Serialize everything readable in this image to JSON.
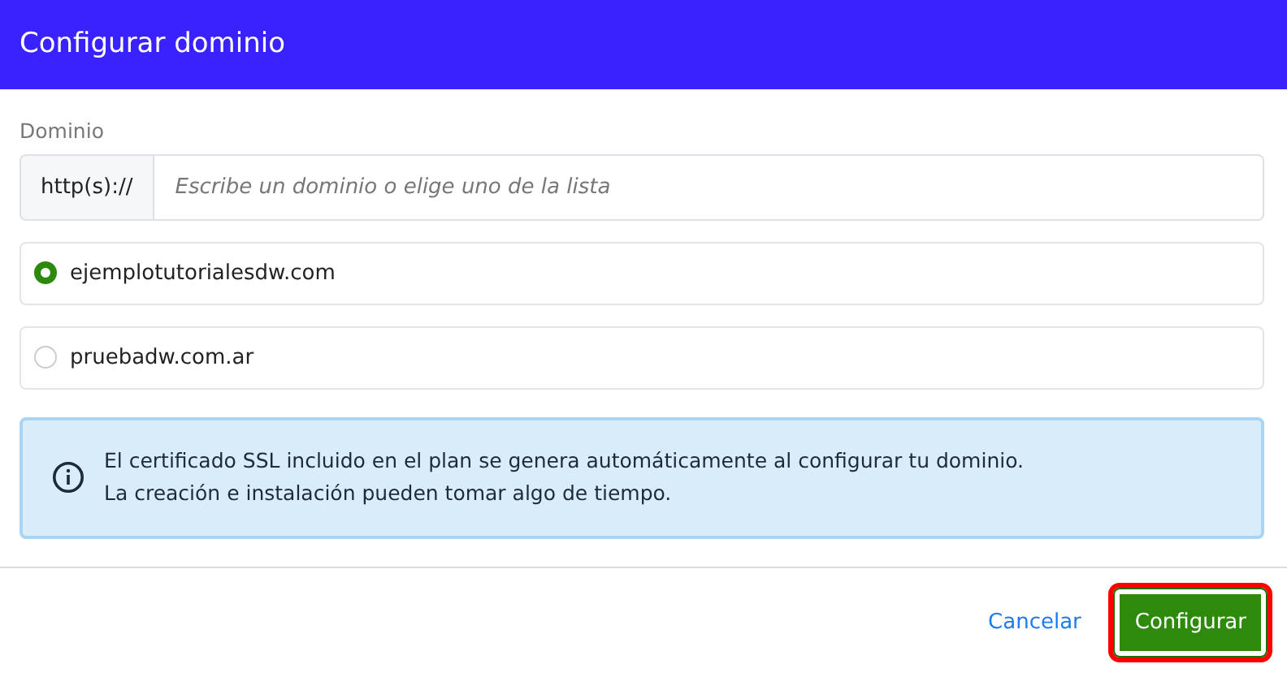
{
  "header": {
    "title": "Configurar dominio"
  },
  "domain_field": {
    "label": "Dominio",
    "prefix": "http(s)://",
    "placeholder": "Escribe un dominio o elige uno de la lista"
  },
  "options": [
    {
      "label": "ejemplotutorialesdw.com",
      "selected": true
    },
    {
      "label": "pruebadw.com.ar",
      "selected": false
    }
  ],
  "alert": {
    "lines": [
      "El certificado SSL incluido en el plan se genera automáticamente al configurar tu dominio.",
      "La creación e instalación pueden tomar algo de tiempo."
    ]
  },
  "footer": {
    "cancel": "Cancelar",
    "submit": {
      "label": "Configurar",
      "highlighted": true
    }
  }
}
